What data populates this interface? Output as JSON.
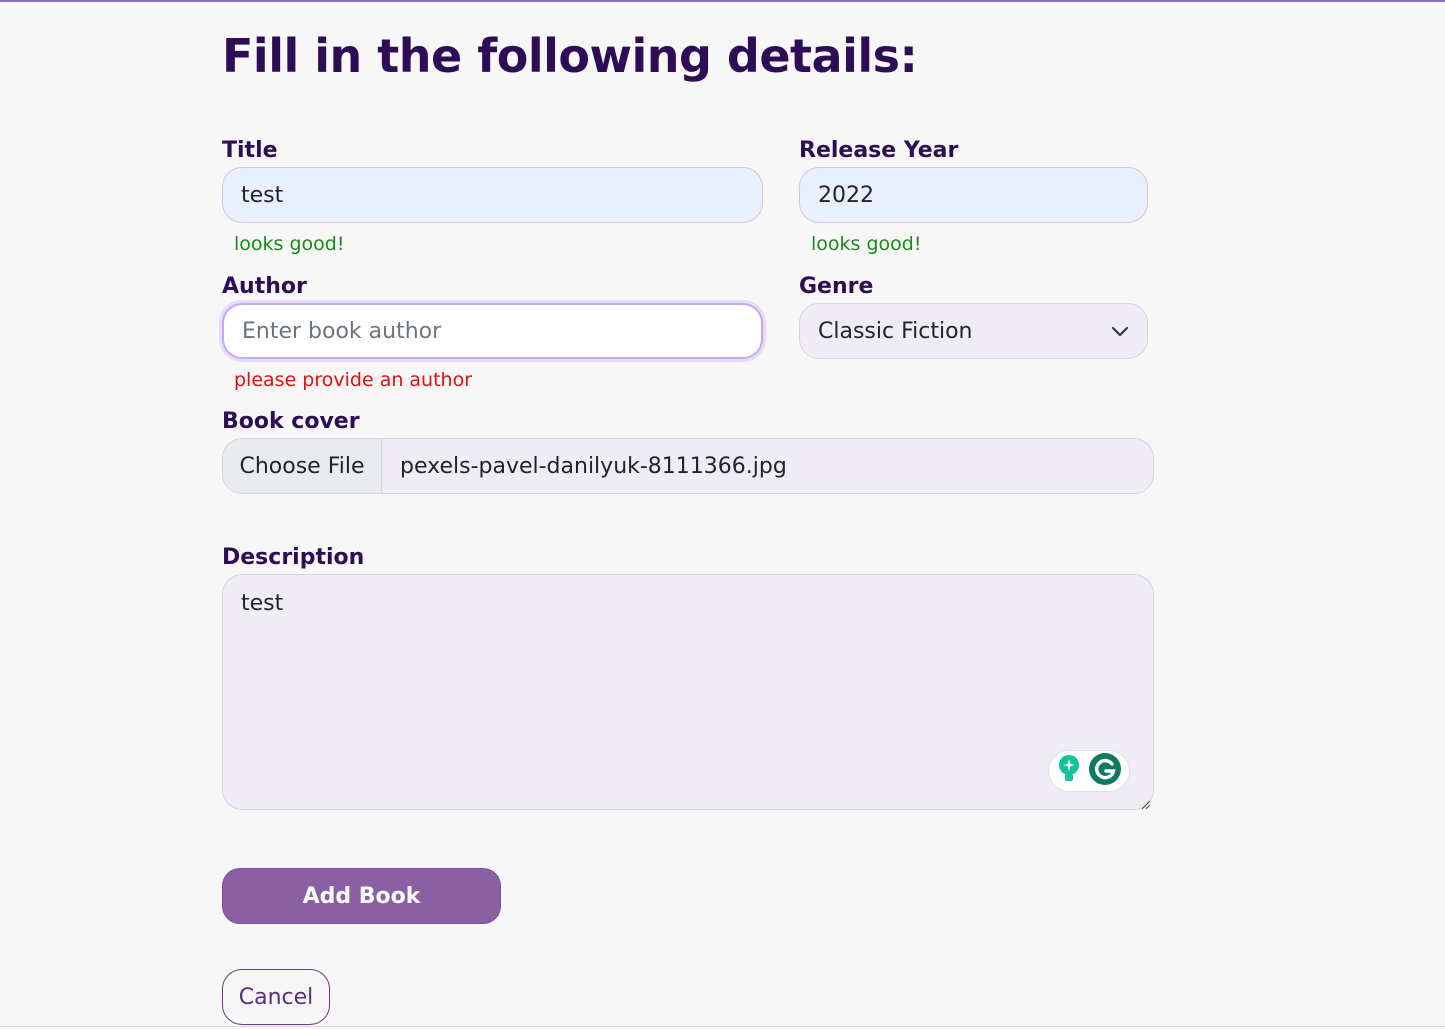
{
  "page": {
    "title": "Fill in the following details:"
  },
  "form": {
    "title_field": {
      "label": "Title",
      "value": "test",
      "feedback": "looks good!"
    },
    "release_year_field": {
      "label": "Release Year",
      "value": "2022",
      "feedback": "looks good!"
    },
    "author_field": {
      "label": "Author",
      "value": "",
      "placeholder": "Enter book author",
      "feedback": "please provide an author"
    },
    "genre_field": {
      "label": "Genre",
      "selected": "Classic Fiction"
    },
    "book_cover_field": {
      "label": "Book cover",
      "button_label": "Choose File",
      "file_name": "pexels-pavel-danilyuk-8111366.jpg"
    },
    "description_field": {
      "label": "Description",
      "value": "test"
    }
  },
  "actions": {
    "submit_label": "Add Book",
    "cancel_label": "Cancel"
  },
  "colors": {
    "heading": "#2e0d56",
    "valid": "#198a19",
    "invalid": "#e30e0e",
    "primary_button": "#8a5fa3"
  }
}
